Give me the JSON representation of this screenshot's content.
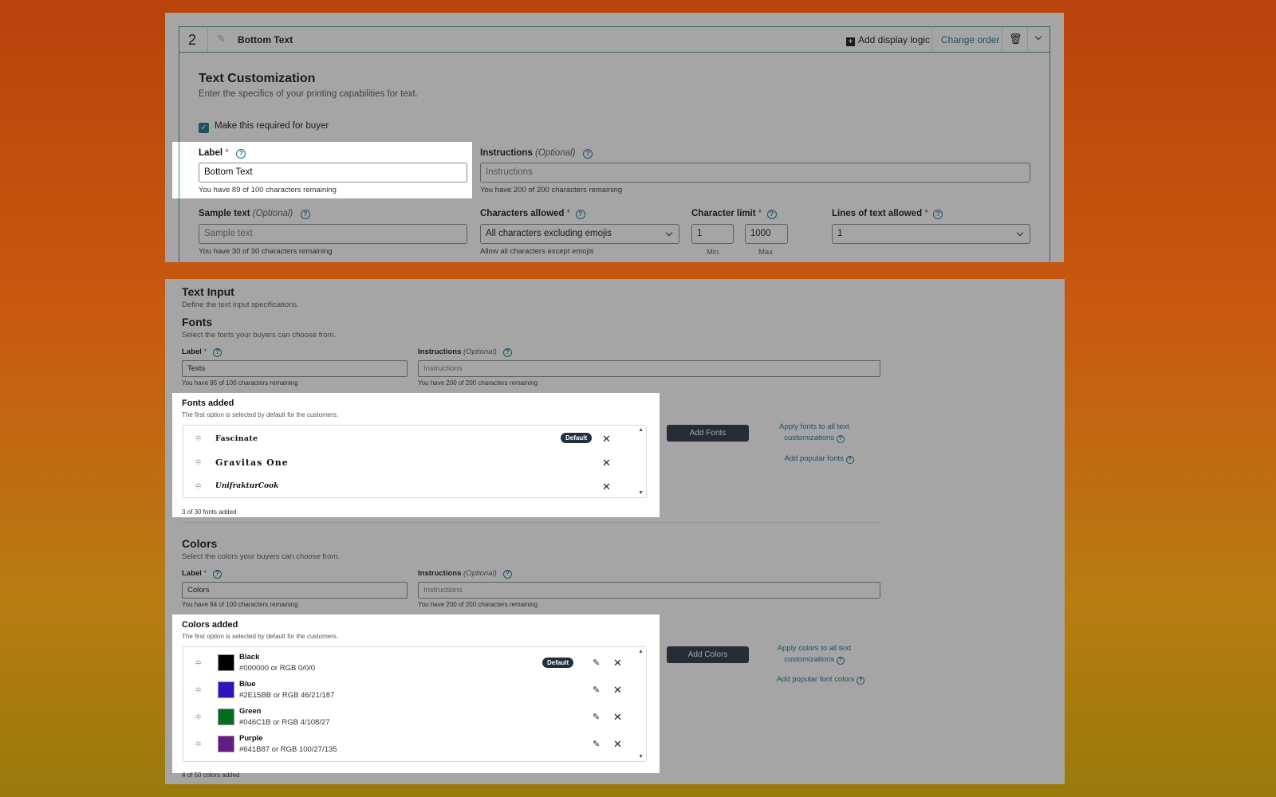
{
  "card": {
    "number": "2",
    "title": "Bottom Text",
    "add_display_logic": "Add display logic",
    "change_order": "Change order",
    "delete_icon": "trash-icon",
    "collapse_icon": "chevron-down-icon"
  },
  "text_customization": {
    "title": "Text Customization",
    "subtitle": "Enter the specifics of your printing capabilities for text.",
    "required_label": "Make this required for buyer",
    "required_checked": true,
    "label": {
      "label": "Label",
      "req": "*",
      "value": "Bottom Text",
      "hint": "You have 89 of 100 characters remaining"
    },
    "instructions": {
      "label": "Instructions",
      "optional": "(Optional)",
      "placeholder": "Instructions",
      "hint": "You have 200 of 200 characters remaining"
    },
    "sample": {
      "label": "Sample text",
      "optional": "(Optional)",
      "placeholder": "Sample text",
      "hint": "You have 30 of 30 characters remaining"
    },
    "chars_allowed": {
      "label": "Characters allowed",
      "req": "*",
      "value": "All characters excluding emojis",
      "hint": "Allow all characters except emojis"
    },
    "char_limit": {
      "label": "Character limit",
      "req": "*",
      "min": "1",
      "max": "1000",
      "min_caption": "Min",
      "max_caption": "Max"
    },
    "lines": {
      "label": "Lines of text allowed",
      "req": "*",
      "value": "1"
    }
  },
  "text_input": {
    "title": "Text Input",
    "subtitle": "Define the text input specifications."
  },
  "fonts": {
    "title": "Fonts",
    "subtitle": "Select the fonts your buyers can choose from.",
    "label": {
      "label": "Label",
      "req": "*",
      "value": "Texts",
      "hint": "You have 95 of 100 characters remaining"
    },
    "instructions": {
      "label": "Instructions",
      "optional": "(Optional)",
      "placeholder": "Instructions",
      "hint": "You have 200 of 200 characters remaining"
    },
    "added_title": "Fonts added",
    "added_subtitle": "The first option is selected by default for the customers.",
    "items": [
      {
        "name": "Fascinate",
        "default": "Default"
      },
      {
        "name": "Gravitas One"
      },
      {
        "name": "UnifrakturCook"
      }
    ],
    "count": "3 of 30 fonts added",
    "add_button": "Add Fonts",
    "apply_link": "Apply fonts to all text customizations",
    "popular_link": "Add popular fonts"
  },
  "colors": {
    "title": "Colors",
    "subtitle": "Select the colors your buyers can choose from.",
    "label": {
      "label": "Label",
      "req": "*",
      "value": "Colors",
      "hint": "You have 94 of 100 characters remaining"
    },
    "instructions": {
      "label": "Instructions",
      "optional": "(Optional)",
      "placeholder": "Instructions",
      "hint": "You have 200 of 200 characters remaining"
    },
    "added_title": "Colors added",
    "added_subtitle": "The first option is selected by default for the customers.",
    "items": [
      {
        "name": "Black",
        "code": "#000000 or RGB 0/0/0",
        "hex": "#000000",
        "default": "Default"
      },
      {
        "name": "Blue",
        "code": "#2E15BB or RGB 46/21/187",
        "hex": "#2E15BB"
      },
      {
        "name": "Green",
        "code": "#046C1B or RGB 4/108/27",
        "hex": "#046C1B"
      },
      {
        "name": "Purple",
        "code": "#641B87 or RGB 100/27/135",
        "hex": "#641B87"
      }
    ],
    "count": "4 of 50 colors added",
    "add_button": "Add Colors",
    "apply_link": "Apply colors to all text customizations",
    "popular_link": "Add popular font colors"
  },
  "colors_theme": {
    "accent": "#1a6e8a",
    "dark_button": "#232f3e"
  }
}
